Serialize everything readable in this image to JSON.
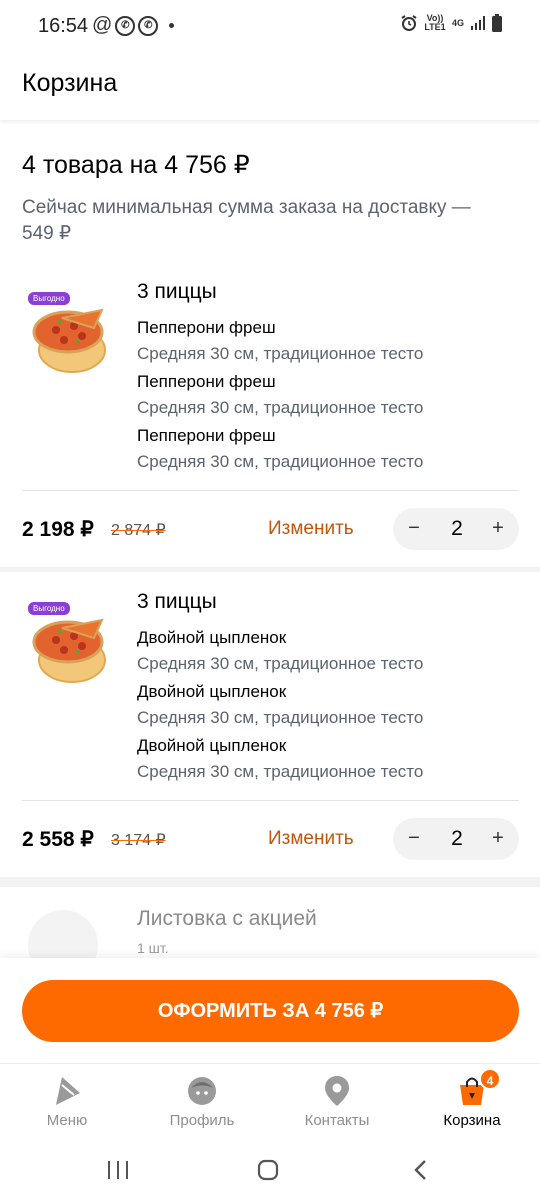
{
  "status_bar": {
    "time": "16:54",
    "network": "Vo)) LTE1",
    "network_type": "4G"
  },
  "header": {
    "title": "Корзина"
  },
  "summary": {
    "title": "4 товара на 4 756 ₽",
    "subtitle": "Сейчас минимальная сумма заказа на доставку — 549 ₽"
  },
  "cart_items": [
    {
      "badge": "Выгодно",
      "title": "3 пиццы",
      "lines": [
        {
          "name": "Пепперони фреш",
          "desc": "Средняя 30 см, традиционное тесто"
        },
        {
          "name": "Пепперони фреш",
          "desc": "Средняя 30 см, традиционное тесто"
        },
        {
          "name": "Пепперони фреш",
          "desc": "Средняя 30 см, традиционное тесто"
        }
      ],
      "price": "2 198 ₽",
      "old_price": "2 874 ₽",
      "edit_label": "Изменить",
      "quantity": "2",
      "minus": "−",
      "plus": "+"
    },
    {
      "badge": "Выгодно",
      "title": "3 пиццы",
      "lines": [
        {
          "name": "Двойной цыпленок",
          "desc": "Средняя 30 см, традиционное тесто"
        },
        {
          "name": "Двойной цыпленок",
          "desc": "Средняя 30 см, традиционное тесто"
        },
        {
          "name": "Двойной цыпленок",
          "desc": "Средняя 30 см, традиционное тесто"
        }
      ],
      "price": "2 558 ₽",
      "old_price": "3 174 ₽",
      "edit_label": "Изменить",
      "quantity": "2",
      "minus": "−",
      "plus": "+"
    }
  ],
  "promo_item": {
    "title": "Листовка с акцией",
    "sub": "1 шт."
  },
  "checkout": {
    "label": "ОФОРМИТЬ ЗА 4 756 ₽"
  },
  "tabs": [
    {
      "label": "Меню",
      "icon": "menu-slice-icon"
    },
    {
      "label": "Профиль",
      "icon": "profile-face-icon"
    },
    {
      "label": "Контакты",
      "icon": "location-pin-icon"
    },
    {
      "label": "Корзина",
      "icon": "cart-bag-icon",
      "badge": "4"
    }
  ],
  "colors": {
    "accent": "#ff6a00",
    "edit_link": "#c4560a",
    "badge_purple": "#8b3fd6"
  }
}
